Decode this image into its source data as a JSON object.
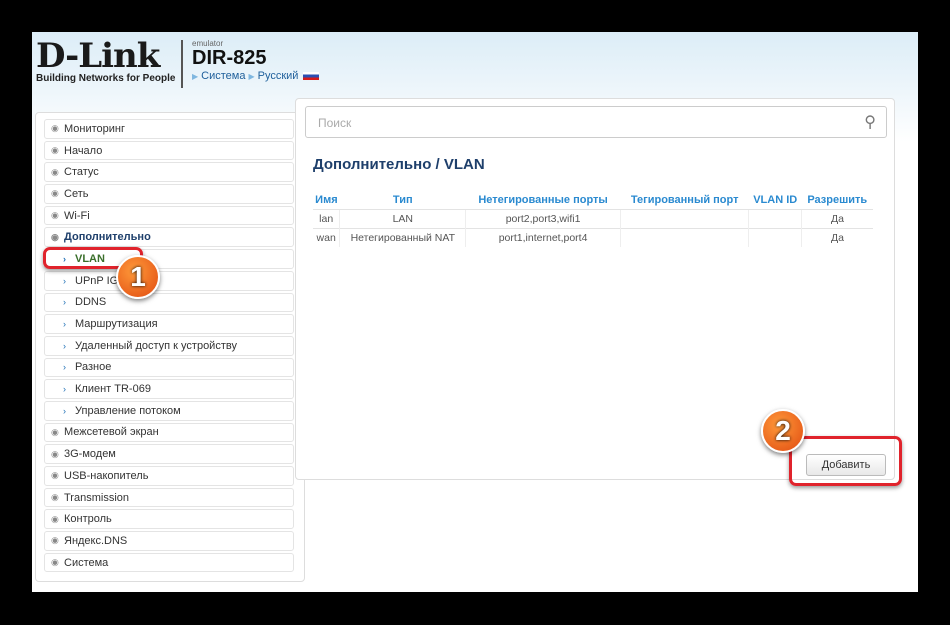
{
  "header": {
    "brand": "D-Link",
    "tagline": "Building Networks for People",
    "emulator": "emulator",
    "model": "DIR-825",
    "crumb_system": "Система",
    "crumb_lang": "Русский"
  },
  "sidebar": {
    "items": [
      {
        "label": "Мониторинг",
        "type": "top"
      },
      {
        "label": "Начало",
        "type": "top"
      },
      {
        "label": "Статус",
        "type": "top"
      },
      {
        "label": "Сеть",
        "type": "top"
      },
      {
        "label": "Wi-Fi",
        "type": "top"
      },
      {
        "label": "Дополнительно",
        "type": "open"
      },
      {
        "label": "VLAN",
        "type": "active"
      },
      {
        "label": "UPnP IGD",
        "type": "sub"
      },
      {
        "label": "DDNS",
        "type": "sub"
      },
      {
        "label": "Маршрутизация",
        "type": "sub"
      },
      {
        "label": "Удаленный доступ к устройству",
        "type": "sub"
      },
      {
        "label": "Разное",
        "type": "sub"
      },
      {
        "label": "Клиент TR-069",
        "type": "sub"
      },
      {
        "label": "Управление потоком",
        "type": "sub"
      },
      {
        "label": "Межсетевой экран",
        "type": "top"
      },
      {
        "label": "3G-модем",
        "type": "top"
      },
      {
        "label": "USB-накопитель",
        "type": "top"
      },
      {
        "label": "Transmission",
        "type": "top"
      },
      {
        "label": "Контроль",
        "type": "top"
      },
      {
        "label": "Яндекс.DNS",
        "type": "top"
      },
      {
        "label": "Система",
        "type": "top"
      }
    ]
  },
  "main": {
    "search_placeholder": "Поиск",
    "title": "Дополнительно /  VLAN",
    "add_label": "Добавить",
    "columns": [
      "Имя",
      "Тип",
      "Нетегированные порты",
      "Тегированный порт",
      "VLAN ID",
      "Разрешить"
    ],
    "rows": [
      [
        "lan",
        "LAN",
        "port2,port3,wifi1",
        "",
        "",
        "Да"
      ],
      [
        "wan",
        "Нетегированный NAT",
        "port1,internet,port4",
        "",
        "",
        "Да"
      ]
    ]
  },
  "annotations": {
    "step1": "1",
    "step2": "2"
  }
}
